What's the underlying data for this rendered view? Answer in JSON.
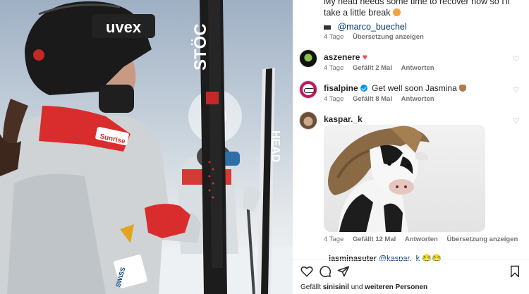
{
  "caption": {
    "text": "My head needs some time to recover now so I'll take a little break",
    "credit_icon": "clapperboard-icon",
    "credit_mention": "@marco_buechel",
    "meta_time": "4 Tage",
    "meta_translate": "Übersetzung anzeigen"
  },
  "comments": [
    {
      "user": "aszenere",
      "text": "",
      "emoji": "♥",
      "time": "4 Tage",
      "likes": "Gefällt 2 Mal",
      "reply": "Antworten"
    },
    {
      "user": "fisalpine",
      "verified": true,
      "text": "Get well soon Jasmina",
      "emoji": "muscle-emoji",
      "time": "4 Tage",
      "likes": "Gefällt 8 Mal",
      "reply": "Antworten"
    },
    {
      "user": "kaspar._k",
      "text": "",
      "time": "4 Tage",
      "likes": "Gefällt 12 Mal",
      "reply": "Antworten",
      "translate": "Übersetzung anzeigen",
      "attachment": "cow-gif"
    }
  ],
  "partial_reply": {
    "user": "jasminasuter",
    "mention": "@kaspar._k",
    "emoji": "😂😂"
  },
  "actions": {
    "like": "heart-icon",
    "comment": "comment-icon",
    "share": "share-icon",
    "save": "bookmark-icon"
  },
  "likes_line": {
    "prefix": "Gefällt",
    "user": "sinisinil",
    "middle": "und",
    "rest": "weiteren Personen"
  },
  "photo_text": {
    "helmet_brand": "uvex",
    "badge": "Sunrise",
    "ski_left": "STÖC",
    "ski_right": "HEAD",
    "jacket": "SWISS"
  },
  "colors": {
    "verified": "#0095f6",
    "mention": "#00376b",
    "meta": "#737373",
    "heart": "#ed4956"
  }
}
